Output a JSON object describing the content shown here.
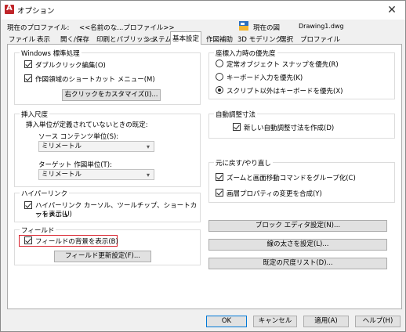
{
  "window": {
    "title": "オプション",
    "close_glyph": "✕"
  },
  "profile": {
    "label": "現在のプロファイル:",
    "value": "<<名前のな...プロファイル>>",
    "drawing_label": "現在の図",
    "drawing_value": "Drawing1.dwg"
  },
  "tabs": [
    {
      "label": "ファイル"
    },
    {
      "label": "表示"
    },
    {
      "label": "開く/保存"
    },
    {
      "label": "印刷とパブリッシュ"
    },
    {
      "label": "システム"
    },
    {
      "label": "基本設定"
    },
    {
      "label": "作図補助"
    },
    {
      "label": "3D モデリング"
    },
    {
      "label": "選択"
    },
    {
      "label": "プロファイル"
    }
  ],
  "windows_std": {
    "title": "Windows 標準処理",
    "double_click": "ダブルクリック編集(O)",
    "shortcut_menu": "作図領域のショートカット メニュー(M)",
    "right_click_button": "右クリックをカスタマイズ(I)..."
  },
  "insert_scale": {
    "title": "挿入尺度",
    "subtitle": "挿入単位が定義されていないときの既定:",
    "source_label": "ソース コンテンツ単位(S):",
    "source_value": "ミリメートル",
    "target_label": "ターゲット 作図単位(T):",
    "target_value": "ミリメートル"
  },
  "hyperlink": {
    "title": "ハイパーリンク",
    "option_line1": "ハイパーリンク カーソル、ツールチップ、ショートカットメニュ",
    "option_line2": "ーを表示(U)"
  },
  "field": {
    "title": "フィールド",
    "background": "フィールドの背景を表示(B)",
    "update_button": "フィールド更新設定(F)..."
  },
  "coord_priority": {
    "title": "座標入力時の優先度",
    "opt1": "定常オブジェクト スナップを優先(R)",
    "opt2": "キーボード入力を優先(K)",
    "opt3": "スクリプト以外はキーボードを優先(X)"
  },
  "assoc_dim": {
    "title": "自動調整寸法",
    "option": "新しい自動調整寸法を作成(D)"
  },
  "undo_redo": {
    "title": "元に戻す/やり直し",
    "opt1": "ズームと画面移動コマンドをグループ化(C)",
    "opt2": "画層プロパティの変更を合成(Y)"
  },
  "right_buttons": {
    "block_editor": "ブロック エディタ設定(N)...",
    "lineweight": "線の太さを設定(L)...",
    "scale_list": "既定の尺度リスト(D)..."
  },
  "footer": {
    "ok": "OK",
    "cancel": "キャンセル",
    "apply": "適用(A)",
    "help": "ヘルプ(H)"
  },
  "colors": {
    "highlight_border": "#d9232e",
    "default_button_border": "#0078d7"
  }
}
